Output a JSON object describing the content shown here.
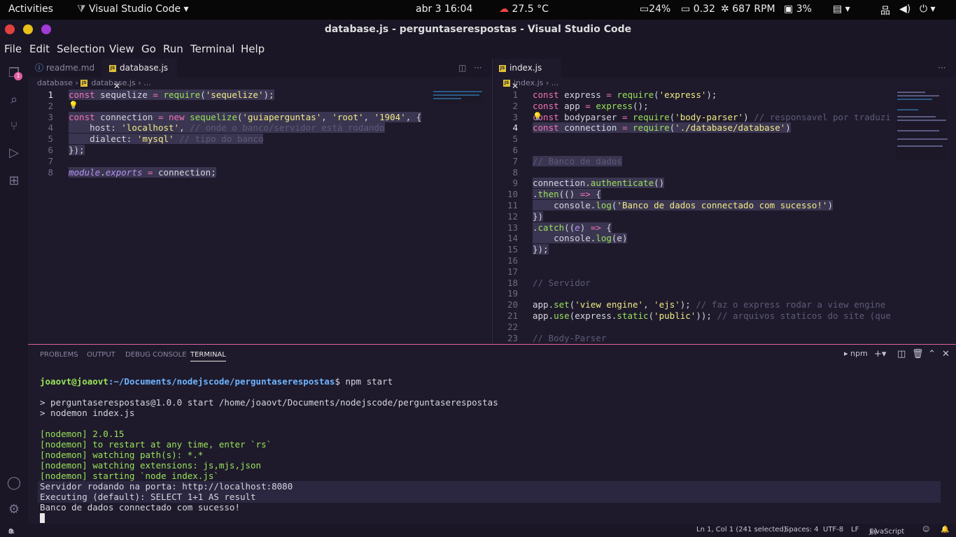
{
  "os_bar": {
    "activities": "Activities",
    "app": "Visual Studio Code",
    "datetime": "abr 3  16:04",
    "weather": "27.5 °C",
    "battery": "24%",
    "load": "0.32",
    "fan": "687 RPM",
    "mem": "3%"
  },
  "window": {
    "title": "database.js - perguntaserespostas - Visual Studio Code"
  },
  "menu": [
    "File",
    "Edit",
    "Selection",
    "View",
    "Go",
    "Run",
    "Terminal",
    "Help"
  ],
  "activity_badge": "1",
  "left_editor": {
    "tabs": [
      {
        "label": "readme.md"
      },
      {
        "label": "database.js"
      }
    ],
    "breadcrumb": [
      "database",
      "database.js",
      "..."
    ],
    "line_numbers": [
      "1",
      "2",
      "3",
      "4",
      "5",
      "6",
      "7",
      "8"
    ]
  },
  "right_editor": {
    "tabs": [
      {
        "label": "index.js"
      }
    ],
    "breadcrumb": [
      "index.js",
      "..."
    ],
    "line_numbers": [
      "1",
      "2",
      "3",
      "4",
      "5",
      "6",
      "7",
      "8",
      "9",
      "10",
      "11",
      "12",
      "13",
      "14",
      "15",
      "16",
      "17",
      "18",
      "19",
      "20",
      "21",
      "22",
      "23"
    ]
  },
  "left_code": [
    [
      [
        "const ",
        "k"
      ],
      [
        "sequelize ",
        ""
      ],
      [
        "= ",
        "k"
      ],
      [
        "require",
        "fn"
      ],
      [
        "(",
        ""
      ],
      [
        "'sequelize'",
        "s"
      ],
      [
        ");",
        ""
      ]
    ],
    [],
    [
      [
        "const ",
        "k"
      ],
      [
        "connection ",
        ""
      ],
      [
        "= ",
        "k"
      ],
      [
        "new ",
        "k"
      ],
      [
        "sequelize",
        "fn"
      ],
      [
        "(",
        ""
      ],
      [
        "'guiaperguntas'",
        "s"
      ],
      [
        ", ",
        ""
      ],
      [
        "'root'",
        "s"
      ],
      [
        ", ",
        ""
      ],
      [
        "'1904'",
        "s"
      ],
      [
        ", {",
        ""
      ]
    ],
    [
      [
        "    host: ",
        ""
      ],
      [
        "'localhost'",
        "s"
      ],
      [
        ", ",
        ""
      ],
      [
        "// onde o banco/servidor está rodando",
        "c"
      ]
    ],
    [
      [
        "    dialect: ",
        ""
      ],
      [
        "'mysql'",
        "s"
      ],
      [
        " ",
        ""
      ],
      [
        "// tipo do banco",
        "c"
      ]
    ],
    [
      [
        "});",
        ""
      ]
    ],
    [],
    [
      [
        "module",
        "it"
      ],
      [
        ".",
        ""
      ],
      [
        "exports",
        "it"
      ],
      [
        " = ",
        "k"
      ],
      [
        "connection;",
        ""
      ]
    ]
  ],
  "right_code": [
    [
      [
        "const ",
        "k"
      ],
      [
        "express ",
        ""
      ],
      [
        "= ",
        "k"
      ],
      [
        "require",
        "fn"
      ],
      [
        "(",
        ""
      ],
      [
        "'express'",
        "s"
      ],
      [
        ");",
        ""
      ]
    ],
    [
      [
        "const ",
        "k"
      ],
      [
        "app ",
        ""
      ],
      [
        "= ",
        "k"
      ],
      [
        "express",
        "fn"
      ],
      [
        "();",
        ""
      ]
    ],
    [
      [
        "const ",
        "k"
      ],
      [
        "bodyparser ",
        ""
      ],
      [
        "= ",
        "k"
      ],
      [
        "require",
        "fn"
      ],
      [
        "(",
        ""
      ],
      [
        "'body-parser'",
        "s"
      ],
      [
        ") ",
        ""
      ],
      [
        "// responsavel por traduzir os",
        "c"
      ]
    ],
    [
      [
        "const ",
        "k"
      ],
      [
        "connection ",
        ""
      ],
      [
        "= ",
        "k"
      ],
      [
        "require",
        "fn"
      ],
      [
        "(",
        ""
      ],
      [
        "'./database/database'",
        "s"
      ],
      [
        ")",
        ""
      ]
    ],
    [],
    [],
    [
      [
        "// Banco de dados",
        "c"
      ]
    ],
    [],
    [
      [
        "connection.",
        ""
      ],
      [
        "authenticate",
        "fn"
      ],
      [
        "()",
        ""
      ]
    ],
    [
      [
        ".",
        ""
      ],
      [
        "then",
        "fn"
      ],
      [
        "(() ",
        ""
      ],
      [
        "=> ",
        "k"
      ],
      [
        "{",
        ""
      ]
    ],
    [
      [
        "    console.",
        ""
      ],
      [
        "log",
        "fn"
      ],
      [
        "(",
        ""
      ],
      [
        "'Banco de dados connectado com sucesso!'",
        "s"
      ],
      [
        ")",
        ""
      ]
    ],
    [
      [
        "})",
        ""
      ]
    ],
    [
      [
        ".",
        ""
      ],
      [
        "catch",
        "fn"
      ],
      [
        "((",
        ""
      ],
      [
        "e",
        "it"
      ],
      [
        ") ",
        ""
      ],
      [
        "=> ",
        "k"
      ],
      [
        "{",
        ""
      ]
    ],
    [
      [
        "    console.",
        ""
      ],
      [
        "log",
        "fn"
      ],
      [
        "(e)",
        ""
      ]
    ],
    [
      [
        "});",
        ""
      ]
    ],
    [],
    [],
    [
      [
        "// Servidor",
        "c"
      ]
    ],
    [],
    [
      [
        "app.",
        ""
      ],
      [
        "set",
        "fn"
      ],
      [
        "(",
        ""
      ],
      [
        "'view engine'",
        "s"
      ],
      [
        ", ",
        ""
      ],
      [
        "'ejs'",
        "s"
      ],
      [
        "); ",
        ""
      ],
      [
        "// faz o express rodar a view engine EJS (",
        "c"
      ]
    ],
    [
      [
        "app.",
        ""
      ],
      [
        "use",
        "fn"
      ],
      [
        "(express.",
        ""
      ],
      [
        "static",
        "fn"
      ],
      [
        "(",
        ""
      ],
      [
        "'public'",
        "s"
      ],
      [
        ")); ",
        ""
      ],
      [
        "// arquivos staticos do site (que não",
        "c"
      ]
    ],
    [],
    [
      [
        "// Body-Parser",
        "c"
      ]
    ]
  ],
  "panel_tabs": [
    "PROBLEMS",
    "OUTPUT",
    "DEBUG CONSOLE",
    "TERMINAL"
  ],
  "terminal": {
    "shell_name": "npm",
    "prompt_user": "joaovt@joaovt",
    "prompt_path": ":~/Documents/nodejscode/perguntaserespostas",
    "command": "$ npm start",
    "lines": [
      "> perguntaserespostas@1.0.0 start /home/joaovt/Documents/nodejscode/perguntaserespostas",
      "> nodemon index.js",
      "",
      "[nodemon] 2.0.15",
      "[nodemon] to restart at any time, enter `rs`",
      "[nodemon] watching path(s): *.*",
      "[nodemon] watching extensions: js,mjs,json",
      "[nodemon] starting `node index.js`",
      "Servidor rodando na porta: http://localhost:8080",
      "Executing (default): SELECT 1+1 AS result",
      "Banco de dados connectado com sucesso!"
    ]
  },
  "status": {
    "errors": "0",
    "warnings": "0",
    "position": "Ln 1, Col 1 (241 selected)",
    "spaces": "Spaces: 4",
    "encoding": "UTF-8",
    "eol": "LF",
    "language": "JavaScript"
  }
}
